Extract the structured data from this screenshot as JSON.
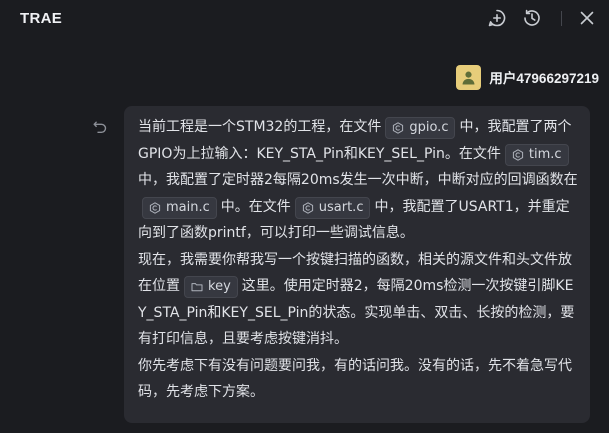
{
  "app": {
    "title": "TRAE"
  },
  "header": {
    "icons": [
      "new-chat-icon",
      "history-icon",
      "close-icon"
    ]
  },
  "user": {
    "name": "用户47966297219",
    "avatar_icon": "user-icon",
    "avatar_color": "#e7cd7a"
  },
  "message": {
    "p1": {
      "t1": "当前工程是一个STM32的工程，在文件",
      "f1": "gpio.c",
      "t2": "中，我配置了两个GPIO为上拉输入：KEY_STA_Pin和KEY_SEL_Pin。在文件",
      "f2": "tim.c",
      "t3": "中，我配置了定时器2每隔20ms发生一次中断，中断对应的回调函数在",
      "f3": "main.c",
      "t4": "中。在文件",
      "f4": "usart.c",
      "t5": "中，我配置了USART1，并重定向到了函数printf，可以打印一些调试信息。"
    },
    "p2": {
      "t1": "现在，我需要你帮我写一个按键扫描的函数，相关的源文件和头文件放在位置",
      "d1": "key",
      "t2": "这里。使用定时器2，每隔20ms检测一次按键引脚KEY_STA_Pin和KEY_SEL_Pin的状态。实现单击、双击、长按的检测，要有打印信息，且要考虑按键消抖。"
    },
    "p3": "你先考虑下有没有问题要问我，有的话问我。没有的话，先不着急写代码，先考虑下方案。"
  }
}
